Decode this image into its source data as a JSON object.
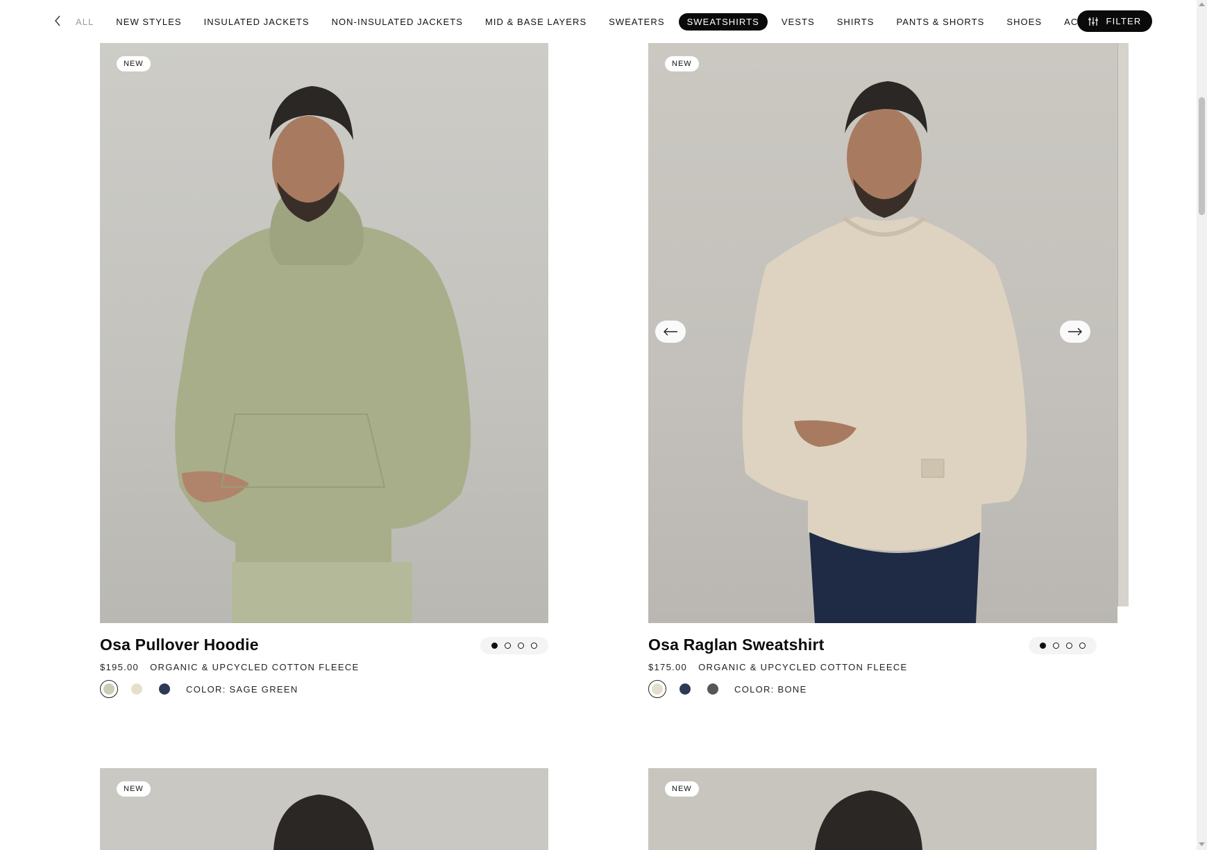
{
  "nav": {
    "items": [
      {
        "label": "ALL"
      },
      {
        "label": "NEW STYLES"
      },
      {
        "label": "INSULATED JACKETS"
      },
      {
        "label": "NON-INSULATED JACKETS"
      },
      {
        "label": "MID & BASE LAYERS"
      },
      {
        "label": "SWEATERS"
      },
      {
        "label": "SWEATSHIRTS"
      },
      {
        "label": "VESTS"
      },
      {
        "label": "SHIRTS"
      },
      {
        "label": "PANTS & SHORTS"
      },
      {
        "label": "SHOES"
      },
      {
        "label": "ACCESSORIES"
      }
    ],
    "active": "SWEATSHIRTS",
    "filter_label": "FILTER"
  },
  "products": [
    {
      "badge": "NEW",
      "title": "Osa Pullover Hoodie",
      "price": "$195.00",
      "material": "ORGANIC & UPCYCLED COTTON FLEECE",
      "color_label": "COLOR: SAGE GREEN",
      "swatch_colors": [
        "#c9ceb6",
        "#e6dfcc",
        "#2e3a55"
      ],
      "image_slides": 4,
      "active_slide": 1,
      "garment_color": "#a9af8b"
    },
    {
      "badge": "NEW",
      "title": "Osa Raglan Sweatshirt",
      "price": "$175.00",
      "material": "ORGANIC & UPCYCLED COTTON FLEECE",
      "color_label": "COLOR: BONE",
      "swatch_colors": [
        "#e3dfcc",
        "#2e3a55",
        "#55575a"
      ],
      "image_slides": 4,
      "active_slide": 1,
      "garment_color": "#dfd5c2"
    },
    {
      "badge": "NEW"
    },
    {
      "badge": "NEW"
    }
  ],
  "colors": {
    "accent": "#0a0a0a",
    "photo_bg_left": "#c5c4bf",
    "photo_bg_right": "#c4c2bd"
  },
  "icons": {
    "nav_back": "chevron-left-icon",
    "filter": "sliders-icon",
    "carousel_prev": "arrow-left-icon",
    "carousel_next": "arrow-right-icon"
  }
}
